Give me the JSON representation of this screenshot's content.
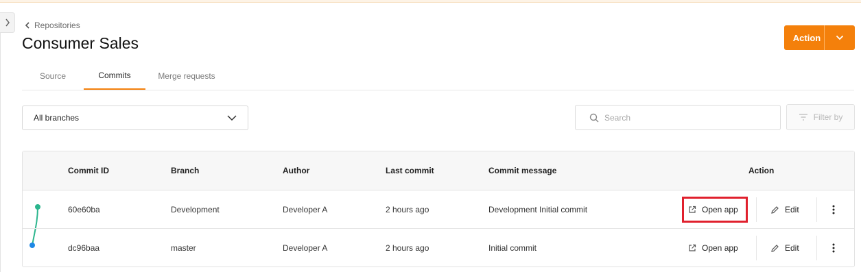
{
  "breadcrumb": {
    "label": "Repositories",
    "icon": "chevron-left-icon"
  },
  "page": {
    "title": "Consumer Sales"
  },
  "header_action": {
    "label": "Action",
    "color": "#f4800b"
  },
  "tabs": [
    {
      "label": "Source",
      "active": false
    },
    {
      "label": "Commits",
      "active": true
    },
    {
      "label": "Merge requests",
      "active": false
    }
  ],
  "branch_filter": {
    "value": "All branches"
  },
  "search": {
    "placeholder": "Search"
  },
  "filter": {
    "label": "Filter by"
  },
  "table": {
    "headers": {
      "commit_id": "Commit ID",
      "branch": "Branch",
      "author": "Author",
      "last_commit": "Last commit",
      "message": "Commit message",
      "action": "Action"
    },
    "rows": [
      {
        "commit_id": "60e60ba",
        "branch": "Development",
        "author": "Developer A",
        "last_commit": "2 hours ago",
        "message": "Development Initial commit",
        "open_label": "Open app",
        "edit_label": "Edit",
        "graph_color": "#2bb58d"
      },
      {
        "commit_id": "dc96baa",
        "branch": "master",
        "author": "Developer A",
        "last_commit": "2 hours ago",
        "message": "Initial commit",
        "open_label": "Open app",
        "edit_label": "Edit",
        "graph_color": "#1e88e5"
      }
    ]
  },
  "highlight": {
    "color": "#e0202d"
  }
}
